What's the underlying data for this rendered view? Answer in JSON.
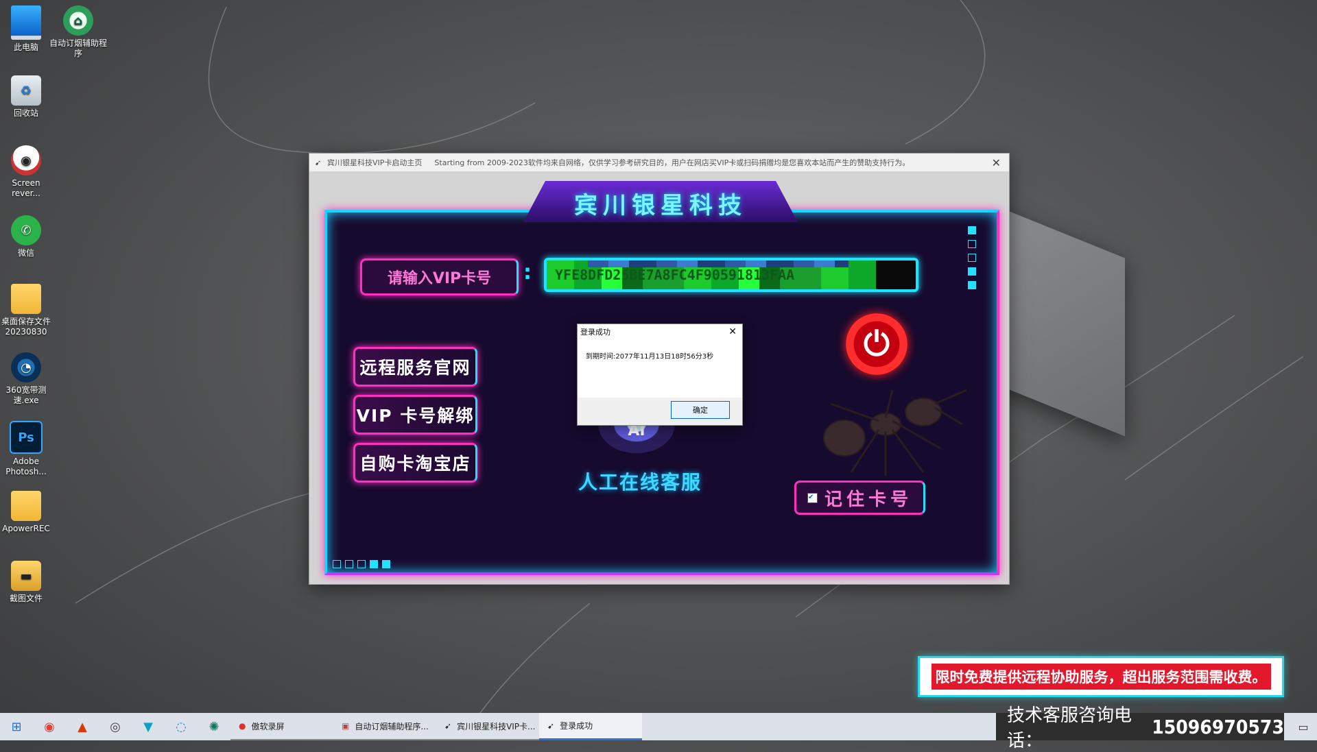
{
  "desktop": {
    "icons": [
      {
        "label": "此电脑",
        "glyph": "",
        "icon": "computer-icon"
      },
      {
        "label": "自动订烟辅助程序",
        "glyph": "⌂",
        "icon": "tobacco-helper-icon"
      },
      {
        "label": "回收站",
        "glyph": "♻",
        "icon": "recycle-bin-icon"
      },
      {
        "label": "Screen rever...",
        "glyph": "◉",
        "icon": "screen-recorder-icon"
      },
      {
        "label": "微信",
        "glyph": "✆",
        "icon": "wechat-icon"
      },
      {
        "label": "桌面保存文件20230830",
        "glyph": "",
        "icon": "folder-icon"
      },
      {
        "label": "360宽带测速.exe",
        "glyph": "◔",
        "icon": "speedtest-icon"
      },
      {
        "label": "Adobe Photosh...",
        "glyph": "Ps",
        "icon": "photoshop-icon"
      },
      {
        "label": "ApowerREC",
        "glyph": "",
        "icon": "folder-icon"
      },
      {
        "label": "截图文件",
        "glyph": "▬",
        "icon": "screenshot-folder-icon"
      }
    ]
  },
  "window": {
    "title": "宾川银星科技VIP卡启动主页",
    "subtitle": "Starting from 2009-2023软件均来自网络，仅供学习参考研究目的，用户在网店买VIP卡或扫码捐赠均是您喜欢本站而产生的赞助支持行为。",
    "header": "宾川银星科技",
    "vip_label": "请输入VIP卡号",
    "vip_value": "YFE8DFD25BE7A8FC4F90591813FAA",
    "buttons": {
      "remote": "远程服务官网",
      "unbind": "VIP 卡号解绑",
      "shop": "自购卡淘宝店"
    },
    "ai_label": "AI",
    "online_service": "人工在线客服",
    "remember": "记住卡号",
    "remember_check": "✔",
    "power_glyph": "⏻"
  },
  "dialog": {
    "title": "登录成功",
    "message": "到期时间:2077年11月13日18时56分3秒",
    "ok": "确定",
    "close_glyph": "✕"
  },
  "banner": {
    "text": "限时免费提供远程协助服务，超出服务范围需收费。"
  },
  "taskbar": {
    "start_glyph": "⊞",
    "pinned": [
      {
        "name": "chrome-icon",
        "glyph": "◉"
      },
      {
        "name": "office-icon",
        "glyph": "▲"
      },
      {
        "name": "browser-icon",
        "glyph": "◎"
      },
      {
        "name": "vpn-icon",
        "glyph": "▼"
      },
      {
        "name": "chat-icon",
        "glyph": "◌"
      },
      {
        "name": "settings-icon",
        "glyph": "✺"
      }
    ],
    "items": [
      {
        "label": "傲软录屏",
        "glyph": "●"
      },
      {
        "label": "自动订烟辅助程序...",
        "glyph": "▣"
      },
      {
        "label": "宾川银星科技VIP卡...",
        "glyph": "➹"
      },
      {
        "label": "登录成功",
        "glyph": "➹"
      }
    ],
    "hotline_label": "技术客服咨询电话：",
    "hotline_number": "15096970573",
    "notif_glyph": "▭"
  },
  "colors": {
    "neon_cyan": "#16d6ff",
    "neon_pink": "#ff2fc0",
    "panel_bg": "#160a2e",
    "banner_red": "#e3182c"
  }
}
